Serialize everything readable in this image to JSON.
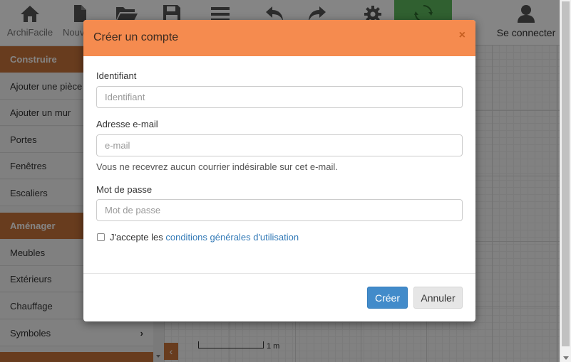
{
  "toolbar": {
    "items": [
      {
        "icon": "home-icon",
        "label": "ArchiFacile"
      },
      {
        "icon": "new-file-icon",
        "label": "Nouv"
      },
      {
        "icon": "open-folder-icon",
        "label": ""
      },
      {
        "icon": "save-icon",
        "label": ""
      },
      {
        "icon": "menu-icon",
        "label": ""
      },
      {
        "icon": "undo-icon",
        "label": ""
      },
      {
        "icon": "redo-icon",
        "label": ""
      },
      {
        "icon": "settings-gear-icon",
        "label": ""
      },
      {
        "icon": "refresh-icon",
        "label": ""
      },
      {
        "icon": "user-icon",
        "label": "Se connecter"
      }
    ],
    "active_color": "#5cb85c"
  },
  "sidebar": {
    "section_construire": "Construire",
    "construire_items": [
      "Ajouter une pièce",
      "Ajouter un mur",
      "Portes",
      "Fenêtres",
      "Escaliers"
    ],
    "section_amenager": "Aménager",
    "amenager_items": [
      "Meubles",
      "Extérieurs",
      "Chauffage",
      "Symboles"
    ],
    "accent_color": "#c7733a"
  },
  "canvas": {
    "scale_label": "1 m"
  },
  "modal": {
    "title": "Créer un compte",
    "close": "×",
    "header_color": "#f58b4f",
    "username": {
      "label": "Identifiant",
      "placeholder": "Identifiant",
      "value": ""
    },
    "email": {
      "label": "Adresse e-mail",
      "placeholder": "e-mail",
      "value": "",
      "help": "Vous ne recevrez aucun courrier indésirable sur cet e-mail."
    },
    "password": {
      "label": "Mot de passe",
      "placeholder": "Mot de passe",
      "value": ""
    },
    "terms": {
      "prefix": "J'accepte les ",
      "link": "conditions générales d'utilisation",
      "checked": false
    },
    "create_button": "Créer",
    "cancel_button": "Annuler"
  }
}
